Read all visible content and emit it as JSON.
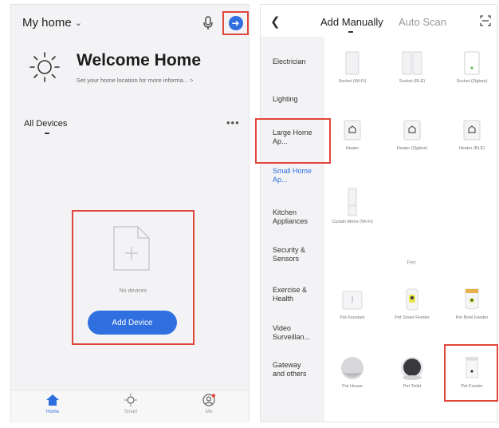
{
  "left": {
    "home_name": "My home",
    "welcome_title": "Welcome Home",
    "welcome_sub": "Set your home location for more informa...",
    "all_devices": "All Devices",
    "no_devices": "No devices",
    "add_device": "Add Device",
    "tabs": [
      {
        "label": "Home",
        "icon": "home-icon"
      },
      {
        "label": "Smart",
        "icon": "smart-icon"
      },
      {
        "label": "Me",
        "icon": "me-icon"
      }
    ]
  },
  "right": {
    "tab_manual": "Add Manually",
    "tab_auto": "Auto Scan",
    "categories": [
      "Electrician",
      "Lighting",
      "Large Home Ap...",
      "Small Home Ap...",
      "Kitchen Appliances",
      "Security & Sensors",
      "Exercise & Health",
      "Video Surveillan...",
      "Gateway and others"
    ],
    "selected_category": "Small Home Ap...",
    "devices": [
      {
        "label": "Socket (Wi-Fi)",
        "icon": "socket-icon"
      },
      {
        "label": "Socket (BLE)",
        "icon": "socket-icon"
      },
      {
        "label": "Socket (Zigbee)",
        "icon": "socket-icon"
      },
      {
        "label": "Heater",
        "icon": "heater-icon"
      },
      {
        "label": "Heater (Zigbee)",
        "icon": "heater-icon"
      },
      {
        "label": "Heater (BLE)",
        "icon": "heater-icon"
      },
      {
        "label": "Curtain Motor (Wi-Fi)",
        "icon": "curtain-icon"
      }
    ],
    "pet_heading": "Pet",
    "pet_devices": [
      {
        "label": "Pet Fountain",
        "icon": "fountain-icon"
      },
      {
        "label": "Pet Smart Feeder",
        "icon": "feeder-icon"
      },
      {
        "label": "Pet Bowl Feeder",
        "icon": "bowl-feeder-icon"
      },
      {
        "label": "Pet House",
        "icon": "pet-house-icon"
      },
      {
        "label": "Pet Toilet",
        "icon": "pet-toilet-icon"
      },
      {
        "label": "Pet Feeder",
        "icon": "pet-feeder-icon"
      }
    ],
    "selected_pet_device": "Pet Feeder"
  },
  "colors": {
    "accent": "#2f6fe0",
    "highlight": "#e0463b",
    "background": "#f3f3f5"
  }
}
